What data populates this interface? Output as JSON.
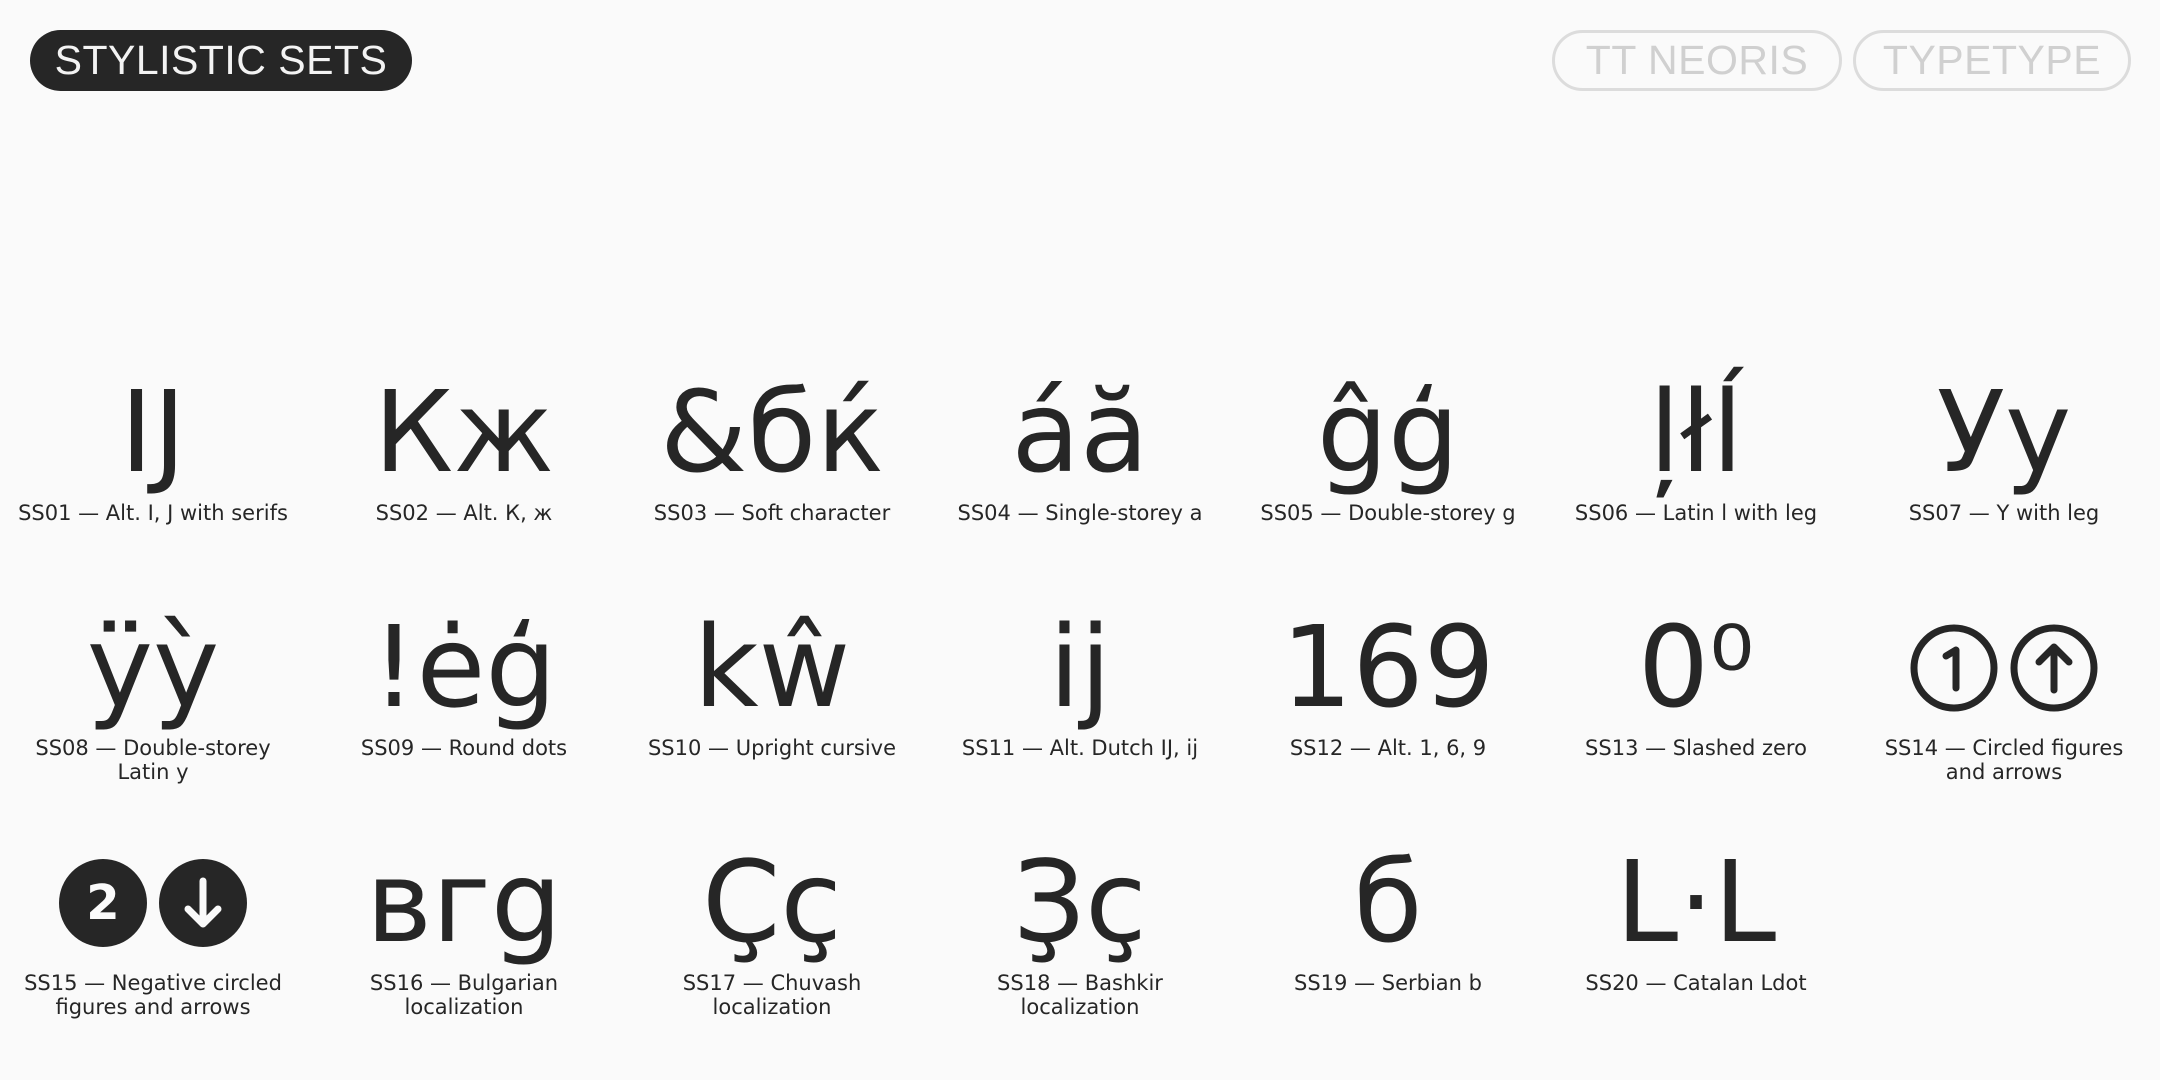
{
  "header": {
    "title": "STYLISTIC SETS",
    "font_name": "TT NEORIS",
    "foundry": "TYPETYPE"
  },
  "sets": [
    {
      "glyph": "IJ",
      "caption": "SS01 — Alt. I, J with serifs"
    },
    {
      "glyph": "Кж",
      "caption": "SS02 — Alt. К, ж"
    },
    {
      "glyph": "&бќ",
      "caption": "SS03 — Soft character"
    },
    {
      "glyph": "áă",
      "caption": "SS04 — Single-storey a"
    },
    {
      "glyph": "ĝģ",
      "caption": "SS05 — Double-storey g"
    },
    {
      "glyph": "ļłĺ",
      "caption": "SS06 — Latin l with leg"
    },
    {
      "glyph": "Уу",
      "caption": "SS07 — Y with leg"
    },
    {
      "glyph": "ÿỳ",
      "caption": "SS08 — Double-storey Latin y"
    },
    {
      "glyph": "!ėģ",
      "caption": "SS09 — Round dots"
    },
    {
      "glyph": "kŵ",
      "caption": "SS10 — Upright cursive"
    },
    {
      "glyph": "ij",
      "caption": "SS11 — Alt. Dutch IJ, ij"
    },
    {
      "glyph": "169",
      "caption": "SS12 — Alt. 1, 6, 9"
    },
    {
      "glyph": "0⁰",
      "caption": "SS13 — Slashed zero"
    },
    {
      "glyph": "①↑",
      "caption": "SS14 — Circled figures and arrows"
    },
    {
      "glyph": "2↓",
      "caption": "SS15 — Negative circled figures and arrows"
    },
    {
      "glyph": "вгg",
      "caption": "SS16 — Bulgarian localization"
    },
    {
      "glyph": "Çç",
      "caption": "SS17 — Chuvash localization"
    },
    {
      "glyph": "Ҙҫ",
      "caption": "SS18 — Bashkir localization"
    },
    {
      "glyph": "б",
      "caption": "SS19 — Serbian b"
    },
    {
      "glyph": "L·L",
      "caption": "SS20 — Catalan Ldot"
    }
  ],
  "colors": {
    "background": "#fafafa",
    "ink": "#262626",
    "outline": "#dcdcdc"
  }
}
